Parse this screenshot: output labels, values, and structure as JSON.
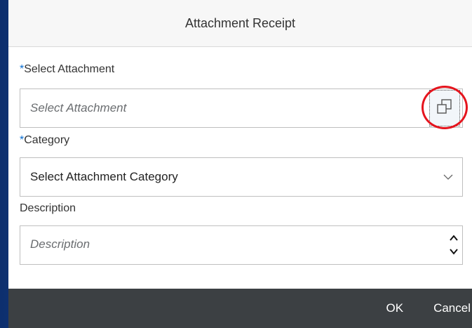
{
  "dialog": {
    "title": "Attachment Receipt"
  },
  "form": {
    "attachment": {
      "required_mark": "*",
      "label": "Select Attachment",
      "placeholder": "Select Attachment",
      "value_help_icon": "value-help-icon"
    },
    "category": {
      "required_mark": "*",
      "label": "Category",
      "selected": "Select Attachment Category",
      "chevron_icon": "chevron-down-icon"
    },
    "description": {
      "label": "Description",
      "placeholder": "Description"
    }
  },
  "footer": {
    "ok_label": "OK",
    "cancel_label": "Cancel"
  },
  "colors": {
    "required": "#0a6ed1",
    "footer_bg": "#3c4043",
    "highlight_ring": "#e5141d",
    "backdrop": "#163f8a"
  }
}
